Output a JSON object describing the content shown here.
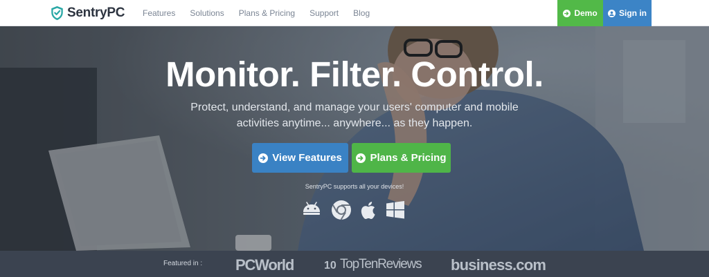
{
  "brand": {
    "name": "SentryPC",
    "logo_icon": "shield-check-icon",
    "colors": {
      "teal": "#2aa8a6",
      "dark": "#2d3440"
    }
  },
  "nav": {
    "links": [
      "Features",
      "Solutions",
      "Plans & Pricing",
      "Support",
      "Blog"
    ],
    "demo": {
      "label": "Demo",
      "icon": "arrow-circle-right-icon",
      "color": "#52b948"
    },
    "signin": {
      "label": "Sign in",
      "icon": "user-circle-icon",
      "color": "#3c84c6"
    }
  },
  "hero": {
    "headline": "Monitor. Filter. Control.",
    "subheadline": "Protect, understand, and manage your users' computer and mobile activities anytime... anywhere... as they happen.",
    "cta_primary": {
      "label": "View Features",
      "icon": "arrow-circle-right-icon",
      "color": "#3a82c4"
    },
    "cta_secondary": {
      "label": "Plans & Pricing",
      "icon": "arrow-circle-right-icon",
      "color": "#4fb548"
    },
    "devices_note": "SentryPC supports all your devices!",
    "device_icons": [
      "android-icon",
      "chrome-icon",
      "apple-icon",
      "windows-icon"
    ]
  },
  "featured": {
    "label": "Featured in :",
    "logos": [
      "PCWorld",
      "TopTenReviews",
      "business.com"
    ],
    "toptenreviews_mark": "10"
  }
}
